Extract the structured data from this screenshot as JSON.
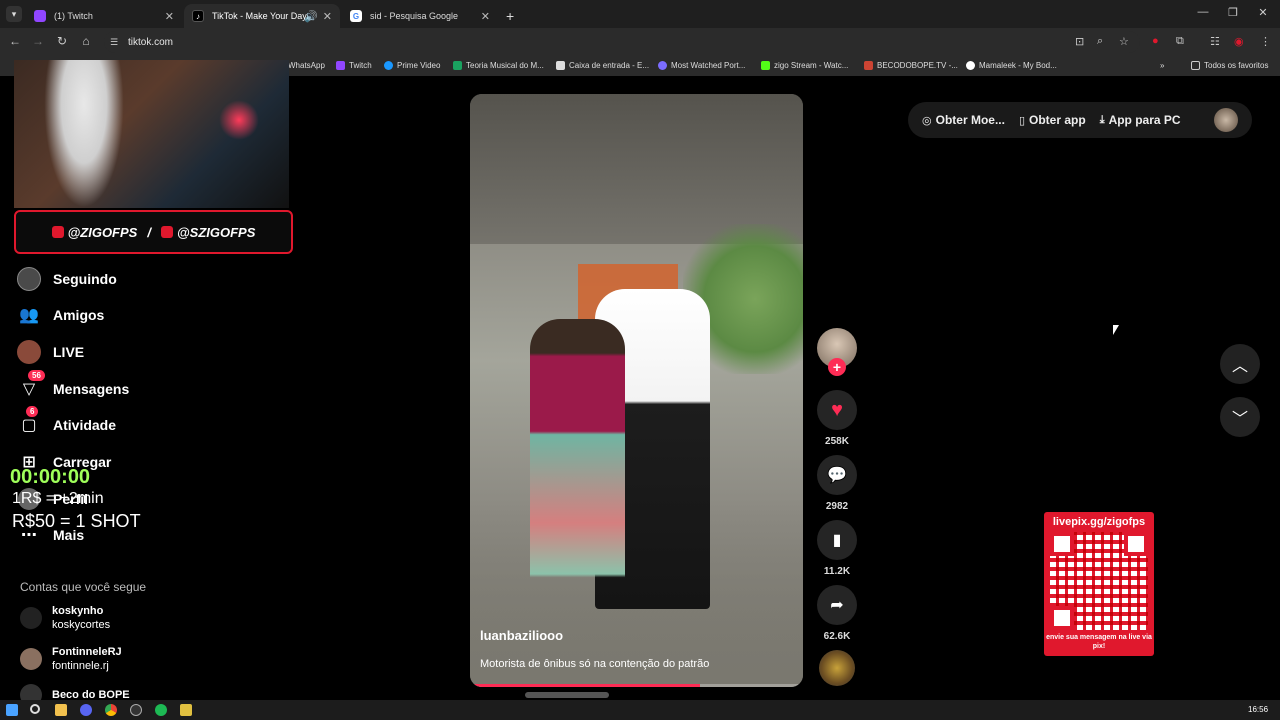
{
  "browser": {
    "tabs": [
      {
        "label": "(1) Twitch",
        "active": false
      },
      {
        "label": "TikTok - Make Your Day",
        "active": true
      },
      {
        "label": "sid - Pesquisa Google",
        "active": false
      }
    ],
    "url": "tiktok.com",
    "bookmarks": [
      "WhatsApp",
      "Twitch",
      "Prime Video",
      "Teoria Musical do M...",
      "Caixa de entrada - E...",
      "Most Watched Port...",
      "zigo Stream - Watc...",
      "BECODOBOPE.TV -...",
      "Mamaleek - My Bod..."
    ],
    "all_bookmarks": "Todos os favoritos",
    "clock": "16:56"
  },
  "overlay": {
    "handle_left": "@ZIGOFPS",
    "separator": "/",
    "handle_right": "@SZIGOFPS",
    "timer": "00:00:00",
    "price1": "1R$ = +2min",
    "price2": "R$50 = 1 SHOT"
  },
  "sidebar": {
    "items": [
      {
        "label": "Seguindo"
      },
      {
        "label": "Amigos"
      },
      {
        "label": "LIVE"
      },
      {
        "label": "Mensagens",
        "badge": "56"
      },
      {
        "label": "Atividade",
        "badge": "6"
      },
      {
        "label": "Carregar"
      },
      {
        "label": "Perfil"
      },
      {
        "label": "Mais"
      }
    ],
    "following_title": "Contas que você segue",
    "accounts": [
      {
        "name": "koskynho",
        "handle": "koskycortes"
      },
      {
        "name": "FontinneleRJ",
        "handle": "fontinnele.rj"
      },
      {
        "name": "Beco do BOPE",
        "handle": ""
      }
    ]
  },
  "video": {
    "author": "luanbaziliooo",
    "caption": "Motorista de ônibus só na contenção do patrão",
    "progress": 0.69
  },
  "actions": {
    "likes": "258K",
    "comments": "2982",
    "saves": "11.2K",
    "shares": "62.6K"
  },
  "topbar": {
    "coins": "Obter Moe...",
    "get_app": "Obter app",
    "pc_app": "App para PC"
  },
  "livepix": {
    "url": "livepix.gg/zigofps",
    "message": "envie sua mensagem na live via pix!"
  }
}
